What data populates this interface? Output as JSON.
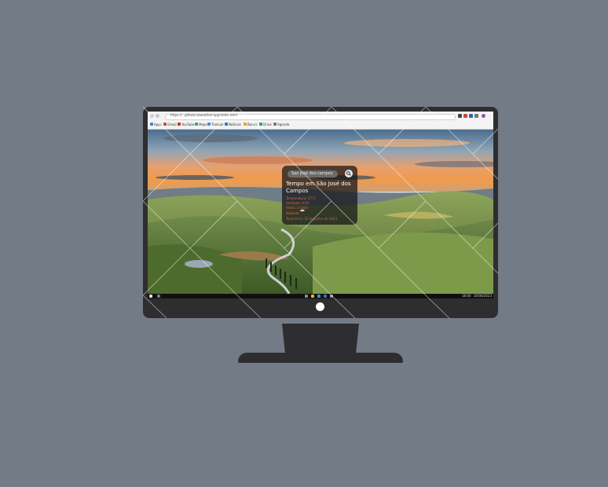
{
  "browser": {
    "url": "https://...github.io/weather-app/index.html",
    "bookmarks": [
      {
        "label": "Apps",
        "color": "#4a7bd8"
      },
      {
        "label": "Gmail",
        "color": "#d44638"
      },
      {
        "label": "YouTube",
        "color": "#e02b20"
      },
      {
        "label": "Maps",
        "color": "#34a853"
      },
      {
        "label": "Traduzir",
        "color": "#4285f4"
      },
      {
        "label": "Notícias",
        "color": "#3a6fd0"
      },
      {
        "label": "Banco",
        "color": "#f0a020"
      },
      {
        "label": "Drive",
        "color": "#2aa860"
      },
      {
        "label": "Agenda",
        "color": "#777777"
      }
    ]
  },
  "weather": {
    "search_placeholder": "Sao jose dos campos",
    "title": "Tempo em São José dos Campos",
    "temperature": "Temperatura: 27°C",
    "humidity": "Umidade: 61%",
    "wind": "Vento: 3 km/h",
    "condition_icon": "cloud-icon",
    "condition": "Nublado",
    "date": "Terça-feira, 20 de junho de 2023"
  },
  "taskbar": {
    "time": "18:00",
    "date": "20/06/2023"
  },
  "colors": {
    "background": "#737b87",
    "monitor": "#2e2e30",
    "accent_text": "#e0604a"
  }
}
